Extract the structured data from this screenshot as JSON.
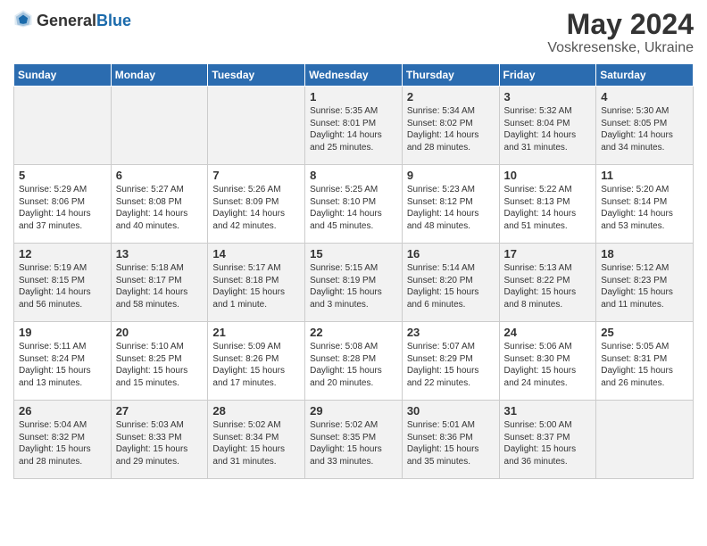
{
  "logo": {
    "general": "General",
    "blue": "Blue"
  },
  "header": {
    "month": "May 2024",
    "location": "Voskresenske, Ukraine"
  },
  "weekdays": [
    "Sunday",
    "Monday",
    "Tuesday",
    "Wednesday",
    "Thursday",
    "Friday",
    "Saturday"
  ],
  "weeks": [
    [
      {
        "day": "",
        "info": ""
      },
      {
        "day": "",
        "info": ""
      },
      {
        "day": "",
        "info": ""
      },
      {
        "day": "1",
        "info": "Sunrise: 5:35 AM\nSunset: 8:01 PM\nDaylight: 14 hours\nand 25 minutes."
      },
      {
        "day": "2",
        "info": "Sunrise: 5:34 AM\nSunset: 8:02 PM\nDaylight: 14 hours\nand 28 minutes."
      },
      {
        "day": "3",
        "info": "Sunrise: 5:32 AM\nSunset: 8:04 PM\nDaylight: 14 hours\nand 31 minutes."
      },
      {
        "day": "4",
        "info": "Sunrise: 5:30 AM\nSunset: 8:05 PM\nDaylight: 14 hours\nand 34 minutes."
      }
    ],
    [
      {
        "day": "5",
        "info": "Sunrise: 5:29 AM\nSunset: 8:06 PM\nDaylight: 14 hours\nand 37 minutes."
      },
      {
        "day": "6",
        "info": "Sunrise: 5:27 AM\nSunset: 8:08 PM\nDaylight: 14 hours\nand 40 minutes."
      },
      {
        "day": "7",
        "info": "Sunrise: 5:26 AM\nSunset: 8:09 PM\nDaylight: 14 hours\nand 42 minutes."
      },
      {
        "day": "8",
        "info": "Sunrise: 5:25 AM\nSunset: 8:10 PM\nDaylight: 14 hours\nand 45 minutes."
      },
      {
        "day": "9",
        "info": "Sunrise: 5:23 AM\nSunset: 8:12 PM\nDaylight: 14 hours\nand 48 minutes."
      },
      {
        "day": "10",
        "info": "Sunrise: 5:22 AM\nSunset: 8:13 PM\nDaylight: 14 hours\nand 51 minutes."
      },
      {
        "day": "11",
        "info": "Sunrise: 5:20 AM\nSunset: 8:14 PM\nDaylight: 14 hours\nand 53 minutes."
      }
    ],
    [
      {
        "day": "12",
        "info": "Sunrise: 5:19 AM\nSunset: 8:15 PM\nDaylight: 14 hours\nand 56 minutes."
      },
      {
        "day": "13",
        "info": "Sunrise: 5:18 AM\nSunset: 8:17 PM\nDaylight: 14 hours\nand 58 minutes."
      },
      {
        "day": "14",
        "info": "Sunrise: 5:17 AM\nSunset: 8:18 PM\nDaylight: 15 hours\nand 1 minute."
      },
      {
        "day": "15",
        "info": "Sunrise: 5:15 AM\nSunset: 8:19 PM\nDaylight: 15 hours\nand 3 minutes."
      },
      {
        "day": "16",
        "info": "Sunrise: 5:14 AM\nSunset: 8:20 PM\nDaylight: 15 hours\nand 6 minutes."
      },
      {
        "day": "17",
        "info": "Sunrise: 5:13 AM\nSunset: 8:22 PM\nDaylight: 15 hours\nand 8 minutes."
      },
      {
        "day": "18",
        "info": "Sunrise: 5:12 AM\nSunset: 8:23 PM\nDaylight: 15 hours\nand 11 minutes."
      }
    ],
    [
      {
        "day": "19",
        "info": "Sunrise: 5:11 AM\nSunset: 8:24 PM\nDaylight: 15 hours\nand 13 minutes."
      },
      {
        "day": "20",
        "info": "Sunrise: 5:10 AM\nSunset: 8:25 PM\nDaylight: 15 hours\nand 15 minutes."
      },
      {
        "day": "21",
        "info": "Sunrise: 5:09 AM\nSunset: 8:26 PM\nDaylight: 15 hours\nand 17 minutes."
      },
      {
        "day": "22",
        "info": "Sunrise: 5:08 AM\nSunset: 8:28 PM\nDaylight: 15 hours\nand 20 minutes."
      },
      {
        "day": "23",
        "info": "Sunrise: 5:07 AM\nSunset: 8:29 PM\nDaylight: 15 hours\nand 22 minutes."
      },
      {
        "day": "24",
        "info": "Sunrise: 5:06 AM\nSunset: 8:30 PM\nDaylight: 15 hours\nand 24 minutes."
      },
      {
        "day": "25",
        "info": "Sunrise: 5:05 AM\nSunset: 8:31 PM\nDaylight: 15 hours\nand 26 minutes."
      }
    ],
    [
      {
        "day": "26",
        "info": "Sunrise: 5:04 AM\nSunset: 8:32 PM\nDaylight: 15 hours\nand 28 minutes."
      },
      {
        "day": "27",
        "info": "Sunrise: 5:03 AM\nSunset: 8:33 PM\nDaylight: 15 hours\nand 29 minutes."
      },
      {
        "day": "28",
        "info": "Sunrise: 5:02 AM\nSunset: 8:34 PM\nDaylight: 15 hours\nand 31 minutes."
      },
      {
        "day": "29",
        "info": "Sunrise: 5:02 AM\nSunset: 8:35 PM\nDaylight: 15 hours\nand 33 minutes."
      },
      {
        "day": "30",
        "info": "Sunrise: 5:01 AM\nSunset: 8:36 PM\nDaylight: 15 hours\nand 35 minutes."
      },
      {
        "day": "31",
        "info": "Sunrise: 5:00 AM\nSunset: 8:37 PM\nDaylight: 15 hours\nand 36 minutes."
      },
      {
        "day": "",
        "info": ""
      }
    ]
  ]
}
